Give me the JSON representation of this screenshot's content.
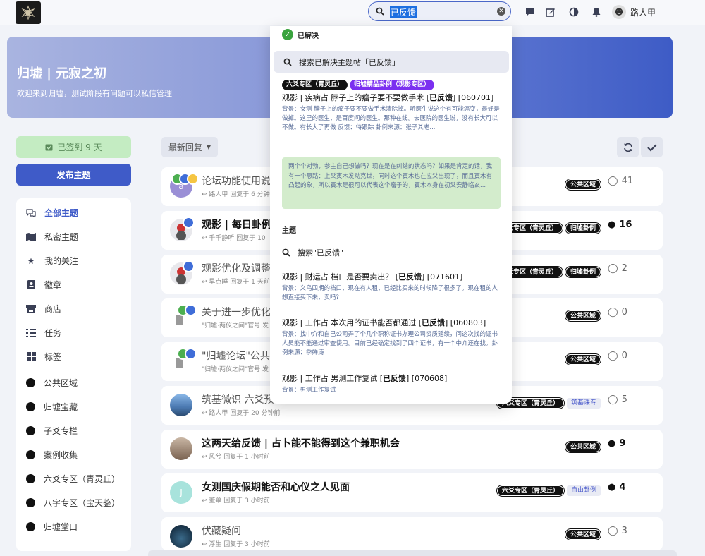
{
  "header": {
    "search_value": "已反馈",
    "user_name": "路人甲",
    "user_avatar_glyph": "☻"
  },
  "hero": {
    "title": "归墟 | 元寂之初",
    "subtitle": "欢迎来到归墟，测试阶段有问题可以私信管理"
  },
  "sidebar": {
    "checkin_label": "已签到 9 天",
    "publish_label": "发布主题",
    "items": [
      {
        "label": "全部主题",
        "icon": "comments-icon"
      },
      {
        "label": "私密主题",
        "icon": "map-icon"
      },
      {
        "label": "我的关注",
        "icon": "star-icon"
      },
      {
        "label": "徽章",
        "icon": "badge-icon"
      },
      {
        "label": "商店",
        "icon": "store-icon"
      },
      {
        "label": "任务",
        "icon": "tasks-icon"
      },
      {
        "label": "标签",
        "icon": "tags-icon"
      },
      {
        "label": "公共区域",
        "icon": "dot"
      },
      {
        "label": "归墟宝藏",
        "icon": "dot"
      },
      {
        "label": "子爻专栏",
        "icon": "dot"
      },
      {
        "label": "案例收集",
        "icon": "dot"
      },
      {
        "label": "六爻专区（青灵丘）",
        "icon": "dot"
      },
      {
        "label": "八字专区（宝天鉴）",
        "icon": "dot"
      },
      {
        "label": "归墟堂口",
        "icon": "dot"
      }
    ]
  },
  "toolbar": {
    "sort_label": "最新回复"
  },
  "discussions": [
    {
      "title": "论坛功能使用说",
      "meta": "路人甲 回复于 6 分钟前",
      "tags": [
        "公共区域"
      ],
      "count": "41",
      "bold": false
    },
    {
      "title": "观影 | 每日卦例",
      "meta": "千千静听 回复于 10",
      "tags": [
        "六爻专区（青灵丘）",
        "归墟卦例"
      ],
      "count": "16",
      "bold": true
    },
    {
      "title": "观影优化及调整",
      "meta": "早点睡 回复于 1 天前",
      "tags": [
        "六爻专区（青灵丘）",
        "归墟卦例"
      ],
      "count": "2",
      "bold": false
    },
    {
      "title": "关于进一步优化",
      "meta": "\"归墟·两仪之间\"官号 发",
      "tags": [
        "公共区域"
      ],
      "count": "0",
      "bold": false
    },
    {
      "title": "\"归墟论坛\"公共区",
      "meta": "\"归墟·两仪之间\"官号 发",
      "tags": [
        "公共区域"
      ],
      "count": "0",
      "bold": false
    },
    {
      "title": "筑基微识 六爻预",
      "meta": "路人甲 回复于 20 分钟前",
      "tags": [
        "六爻专区（青灵丘）",
        "筑基课专"
      ],
      "count": "5",
      "bold": false
    },
    {
      "title": "这两天给反馈 | 占卜能不能得到这个兼职机会",
      "meta": "风兮 回复于 1 小时前",
      "tags": [
        "公共区域"
      ],
      "count": "9",
      "bold": true
    },
    {
      "title": "女测国庆假期能否和心仪之人见面",
      "meta": "董蓽 回复于 3 小时前",
      "tags": [
        "六爻专区（青灵丘）",
        "自由卦例"
      ],
      "count": "4",
      "bold": true
    },
    {
      "title": "伏藏疑问",
      "meta": "浮生 回复于 3 小时前",
      "tags": [
        "公共区域"
      ],
      "count": "3",
      "bold": false
    }
  ],
  "avatar_letters": {
    "row0": "a",
    "row7": "J"
  },
  "dropdown": {
    "solved_label": "已解决",
    "solved_search": "搜索已解决主题帖「已反馈」",
    "result_tags": [
      "六爻专区（青灵丘）",
      "归墟精品卦例（观影专区）"
    ],
    "result_title_pre": "观影 | 疾病占 脖子上的瘤子要不要做手术 [",
    "result_title_hl": "已反馈",
    "result_title_post": "] [060701]",
    "result_desc": "背景：女测 脖子上的瘤子要不要做手术清除掉。听医生说这个有可能癌变，最好是做掉。这里的医生，是百度问的医生。那种在线。去医院的医生说，没有长大可以不做。有长大了再做 反馈：待跟踪 卦例来源：张子爻老...",
    "quote": "两个个对勃，参主自己想做吗？现在是在纠结的状态吗？如果是肯定的话，我有一个思路：上爻寅木发动克世，同时这个寅木也在应爻出现了，而且寅木有凸起的象，所以寅木是很可以代表这个瘤子的，寅木本身在初爻安静临玄...",
    "section_label": "主题",
    "search_topics": "搜索\"已反馈\"",
    "topics": [
      {
        "pre": "观影 | 财运占 档口是否要卖出？ [",
        "hl": "已反馈",
        "post": "] [071601]",
        "desc": "背景：义乌四期的档口，现在有人租，已经比买来的时候降了很多了。现在租的人想直接买下来，卖吗？"
      },
      {
        "pre": "观影 | 工作占 本次用的证书能否都通过 [",
        "hl": "已反馈",
        "post": "] [060803]",
        "desc": "背景：找中介和自己公司弄了个几个职称证书办理公司资质延续，问这次找的证书人员能不能通过审查使用。目前已经确定找到了四个证书，有一个中介还在找。卦例来源：季婵涛"
      },
      {
        "pre": "观影 | 工作占 男测工作复试 [",
        "hl": "已反馈",
        "post": "] [070608]",
        "desc": "背景：男测工作复试"
      }
    ]
  },
  "colors": {
    "accent": "#3f5bc8",
    "checkin_bg": "#c4ecc2",
    "quote_bg": "#d3eccc",
    "tag_purple": "#7b2ff0"
  }
}
